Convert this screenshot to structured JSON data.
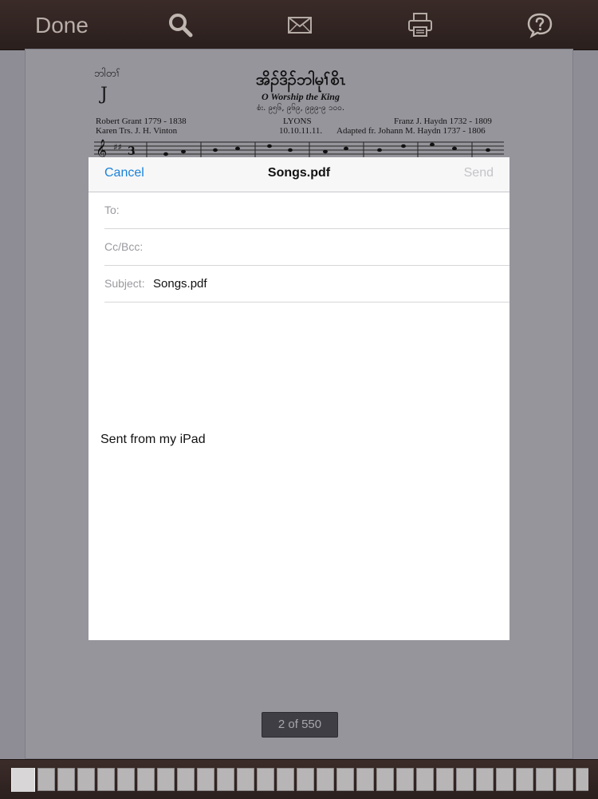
{
  "toolbar": {
    "done_label": "Done",
    "icons": [
      "search-icon",
      "mail-icon",
      "print-icon",
      "help-icon"
    ]
  },
  "sheet": {
    "hymn_number": "ဘါတၢ်",
    "hymn_bar": "J",
    "title": "အိၣ်ဒိၣ်ဘါမုၢ်စိၤ",
    "subtitle": "O Worship the King",
    "reference": "စံး. ၉၅၆, ၉၆၉, ၉၉၉-၉ ၁၀၀.",
    "credits": {
      "author": "Robert Grant 1779 - 1838",
      "translator": "Karen Trs. J. H. Vinton",
      "tune": "LYONS",
      "meter": "10.10.11.11.",
      "composer": "Franz J. Haydn 1732 - 1809",
      "adapted": "Adapted fr. Johann M. Haydn 1737 - 1806"
    }
  },
  "compose": {
    "cancel_label": "Cancel",
    "title": "Songs.pdf",
    "send_label": "Send",
    "to_label": "To:",
    "to_value": "",
    "cc_label": "Cc/Bcc:",
    "cc_value": "",
    "subject_label": "Subject:",
    "subject_value": "Songs.pdf",
    "body": "Sent from my iPad"
  },
  "page_indicator": "2 of 550",
  "colors": {
    "toolbar_bg": "#2f2321",
    "accent_blue": "#1a82d8",
    "send_disabled": "#c4c4c8",
    "overlay_gray": "#8e8d96"
  }
}
